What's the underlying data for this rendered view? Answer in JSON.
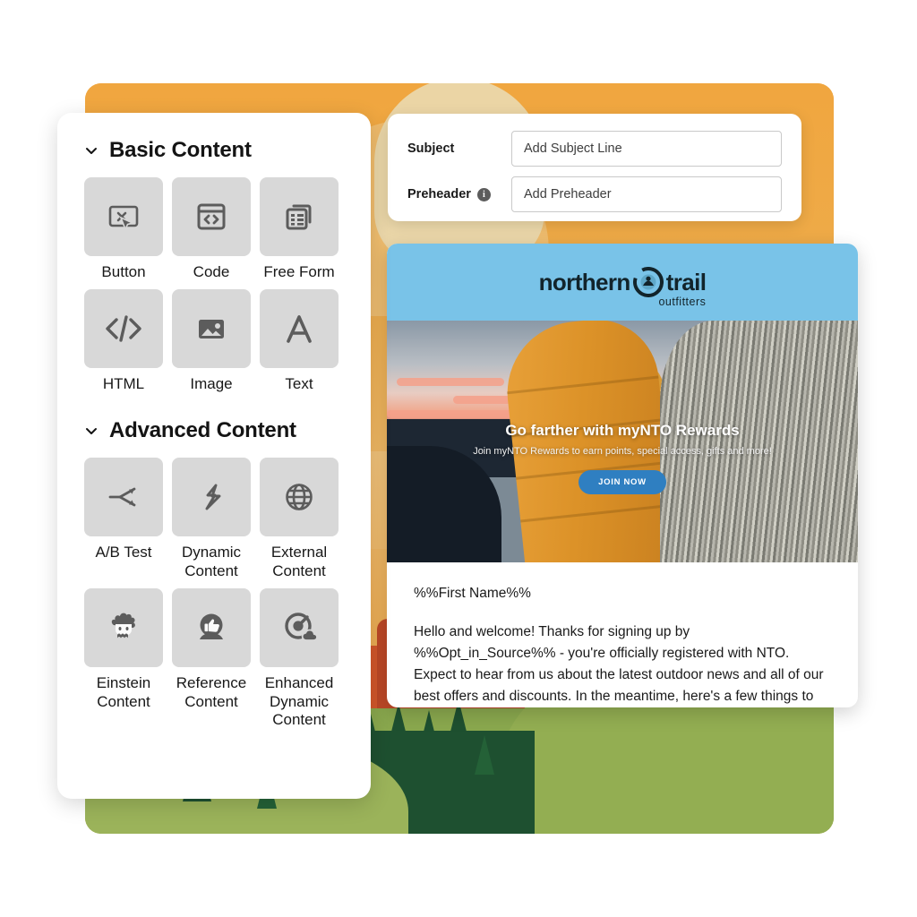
{
  "sidebar": {
    "sections": [
      {
        "title": "Basic Content",
        "chevron_icon": "chevron-down-icon",
        "items": [
          {
            "label": "Button",
            "icon": "button-cursor-icon"
          },
          {
            "label": "Code",
            "icon": "code-window-icon"
          },
          {
            "label": "Free Form",
            "icon": "free-form-layers-icon"
          },
          {
            "label": "HTML",
            "icon": "html-brackets-icon"
          },
          {
            "label": "Image",
            "icon": "image-picture-icon"
          },
          {
            "label": "Text",
            "icon": "text-letter-a-icon"
          }
        ]
      },
      {
        "title": "Advanced Content",
        "chevron_icon": "chevron-down-icon",
        "items": [
          {
            "label": "A/B Test",
            "icon": "ab-test-split-icon"
          },
          {
            "label": "Dynamic Content",
            "icon": "lightning-bolt-icon"
          },
          {
            "label": "External Content",
            "icon": "globe-icon"
          },
          {
            "label": "Einstein Content",
            "icon": "einstein-face-icon"
          },
          {
            "label": "Reference Content",
            "icon": "thumbs-up-circle-icon"
          },
          {
            "label": "Enhanced Dynamic Content",
            "icon": "target-cloud-icon"
          }
        ]
      }
    ]
  },
  "subject_card": {
    "subject": {
      "label": "Subject",
      "value": "",
      "placeholder": "Add Subject Line"
    },
    "preheader": {
      "label": "Preheader",
      "info_icon": "info-icon",
      "info_glyph": "i",
      "value": "",
      "placeholder": "Add Preheader"
    }
  },
  "email_preview": {
    "header": {
      "logo_primary": "northern",
      "logo_secondary": "trail",
      "logo_tagline": "outfitters",
      "logo_mark_icon": "compass-globe-icon",
      "background_color": "#79c3e8"
    },
    "hero": {
      "title": "Go farther with myNTO Rewards",
      "subtitle": "Join myNTO Rewards to earn points, special access, gifts and more!",
      "button_label": "JOIN NOW",
      "button_color": "#2f7fc1"
    },
    "body": {
      "greeting": "%%First Name%%",
      "paragraph": "Hello and welcome! Thanks for signing up by %%Opt_in_Source%% - you're officially registered with NTO. Expect to hear from us about the latest outdoor news and all of our best offers and discounts. In the meantime, here's a few things to get you started."
    }
  },
  "colors": {
    "panel_orange": "#eda33f",
    "tile_gray": "#d8d8d8",
    "email_header_blue": "#79c3e8",
    "cta_blue": "#2f7fc1"
  }
}
